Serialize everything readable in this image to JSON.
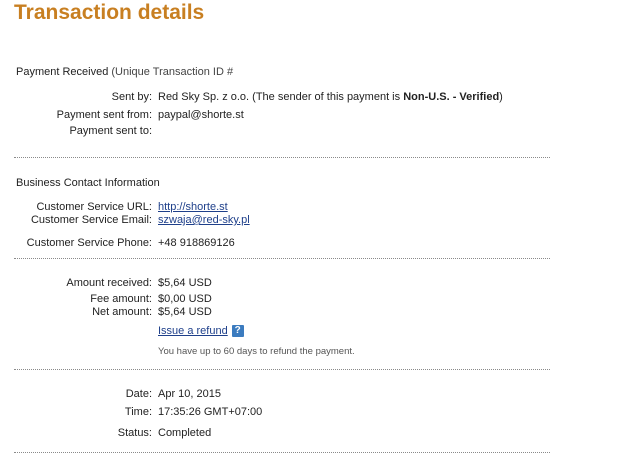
{
  "page": {
    "title": "Transaction details"
  },
  "payment": {
    "heading": "Payment Received",
    "heading_suffix": "(Unique Transaction ID #",
    "sent_by_label": "Sent by:",
    "sent_by_name": "Red Sky Sp. z o.o.",
    "sent_by_note_pre": "(The sender of this payment is",
    "sent_by_status": "Non-U.S. - Verified",
    "sent_by_note_post": ")",
    "sent_from_label": "Payment sent from:",
    "sent_from_value": "paypal@shorte.st",
    "sent_to_label": "Payment sent to:",
    "sent_to_value": ""
  },
  "business": {
    "heading": "Business Contact Information",
    "url_label": "Customer Service URL:",
    "url_value": "http://shorte.st",
    "email_label": "Customer Service Email:",
    "email_value": "szwaja@red-sky.pl",
    "phone_label": "Customer Service Phone:",
    "phone_value": "+48 918869126"
  },
  "amounts": {
    "received_label": "Amount received:",
    "received_value": "$5,64 USD",
    "fee_label": "Fee amount:",
    "fee_value": "$0,00 USD",
    "net_label": "Net amount:",
    "net_value": "$5,64 USD",
    "refund_link": "Issue a refund",
    "help_icon_glyph": "?",
    "refund_note": "You have up to 60 days to refund the payment."
  },
  "meta": {
    "date_label": "Date:",
    "date_value": "Apr 10, 2015",
    "time_label": "Time:",
    "time_value": "17:35:26 GMT+07:00",
    "status_label": "Status:",
    "status_value": "Completed"
  },
  "colors": {
    "title": "#c87f21",
    "link": "#1e3f8a",
    "help_icon": "#3b7bbf"
  }
}
